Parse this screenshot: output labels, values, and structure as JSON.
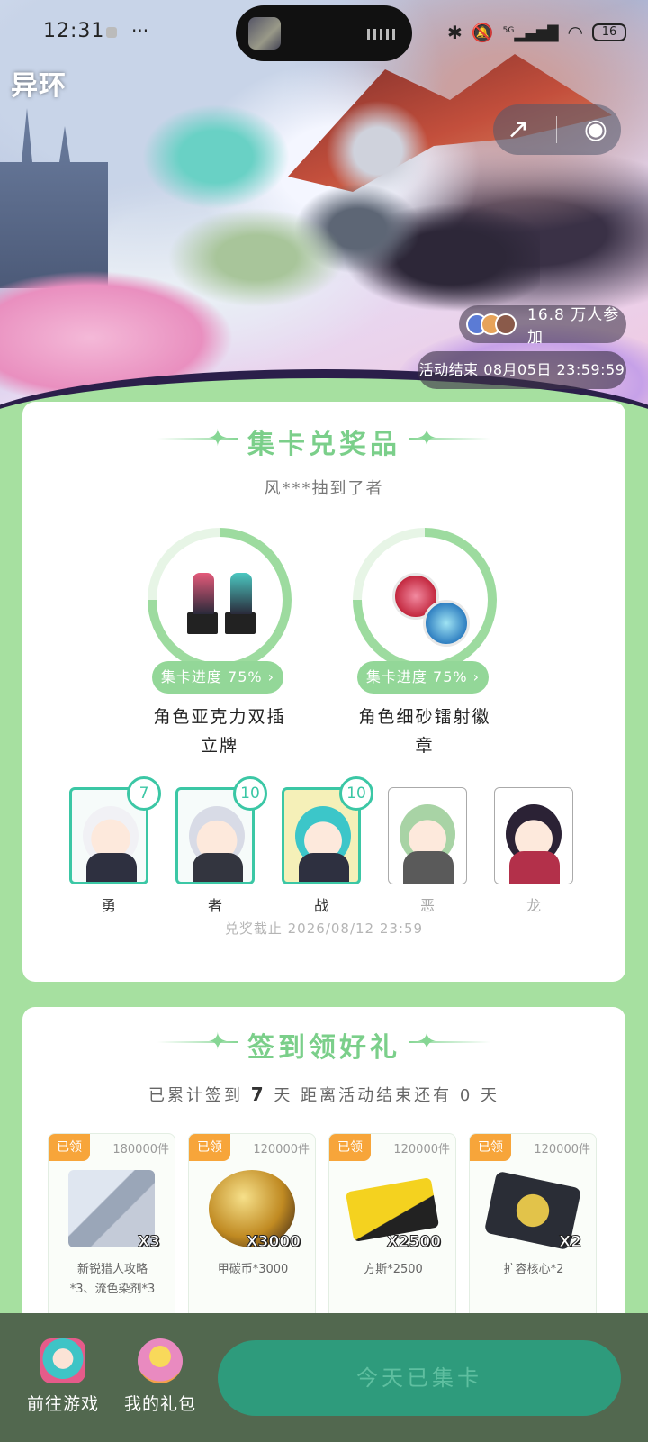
{
  "status_bar": {
    "time": "12:31",
    "dots": "···",
    "network": "5G",
    "battery": "16"
  },
  "hero": {
    "logo": "异环",
    "participants": "16.8 万人参加",
    "event_end": "活动结束 08月05日 23:59:59",
    "share_icon": "share-icon",
    "record_icon": "record-icon"
  },
  "collect": {
    "title": "集卡兑奖品",
    "winner_note": "风***抽到了者",
    "prizes": [
      {
        "progress_label": "集卡进度 75%",
        "progress": 0.75,
        "name_line1": "角色亚克力双插",
        "name_line2": "立牌"
      },
      {
        "progress_label": "集卡进度 75%",
        "progress": 0.75,
        "name_line1": "角色细砂镭射徽",
        "name_line2": "章"
      }
    ],
    "cards": [
      {
        "label": "勇",
        "count": "7",
        "owned": true
      },
      {
        "label": "者",
        "count": "10",
        "owned": true
      },
      {
        "label": "战",
        "count": "10",
        "owned": true
      },
      {
        "label": "恶",
        "count": "",
        "owned": false
      },
      {
        "label": "龙",
        "count": "",
        "owned": false
      }
    ],
    "deadline": "兑奖截止 2026/08/12 23:59"
  },
  "signin": {
    "title": "签到领好礼",
    "summary_prefix": "已累计签到",
    "days_signed": "7",
    "summary_middle": "天 距离活动结束还有",
    "days_left": "0",
    "summary_suffix": "天",
    "rewards": [
      {
        "tag": "已领",
        "stock": "180000件",
        "multiplier": "X3",
        "name_line1": "新锐猎人攻略",
        "name_line2": "*3、流色染剂*3"
      },
      {
        "tag": "已领",
        "stock": "120000件",
        "multiplier": "X3000",
        "name_line1": "甲碳币*3000",
        "name_line2": ""
      },
      {
        "tag": "已领",
        "stock": "120000件",
        "multiplier": "X2500",
        "name_line1": "方斯*2500",
        "name_line2": ""
      },
      {
        "tag": "已领",
        "stock": "120000件",
        "multiplier": "X2",
        "name_line1": "扩容核心*2",
        "name_line2": ""
      }
    ]
  },
  "bottom_bar": {
    "go_game": "前往游戏",
    "my_gifts": "我的礼包",
    "cta": "今天已集卡"
  },
  "colors": {
    "page_bg": "#a6e0a0",
    "accent_green": "#7bcf8a",
    "teal": "#3bc7a5",
    "tag_orange": "#f7a53a",
    "bottom_bg": "#52684f",
    "cta_bg": "#2e9b7c"
  }
}
